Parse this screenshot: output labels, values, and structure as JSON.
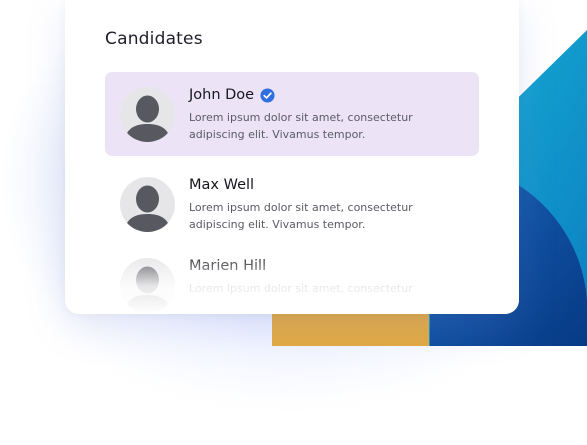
{
  "card": {
    "title": "Candidates"
  },
  "candidates": [
    {
      "name": "John Doe",
      "verified": true,
      "description": "Lorem ipsum dolor sit amet, consectetur adipiscing elit. Vivamus tempor.",
      "selected": true
    },
    {
      "name": "Max Well",
      "verified": false,
      "description": "Lorem ipsum dolor sit amet, consectetur adipiscing elit. Vivamus tempor.",
      "selected": false
    },
    {
      "name": "Marien Hill",
      "verified": false,
      "description": "Lorem ipsum dolor sit amet, consectetur",
      "selected": false
    }
  ],
  "icons": {
    "avatar": "person-silhouette-icon",
    "verified": "verified-check-icon"
  },
  "colors": {
    "selected_row": "#ece4f6",
    "verified_badge": "#2f6fe0",
    "deco_teal": "#0e94c8",
    "deco_navy": "#0a4a9a",
    "deco_gold": "#e2a942"
  }
}
